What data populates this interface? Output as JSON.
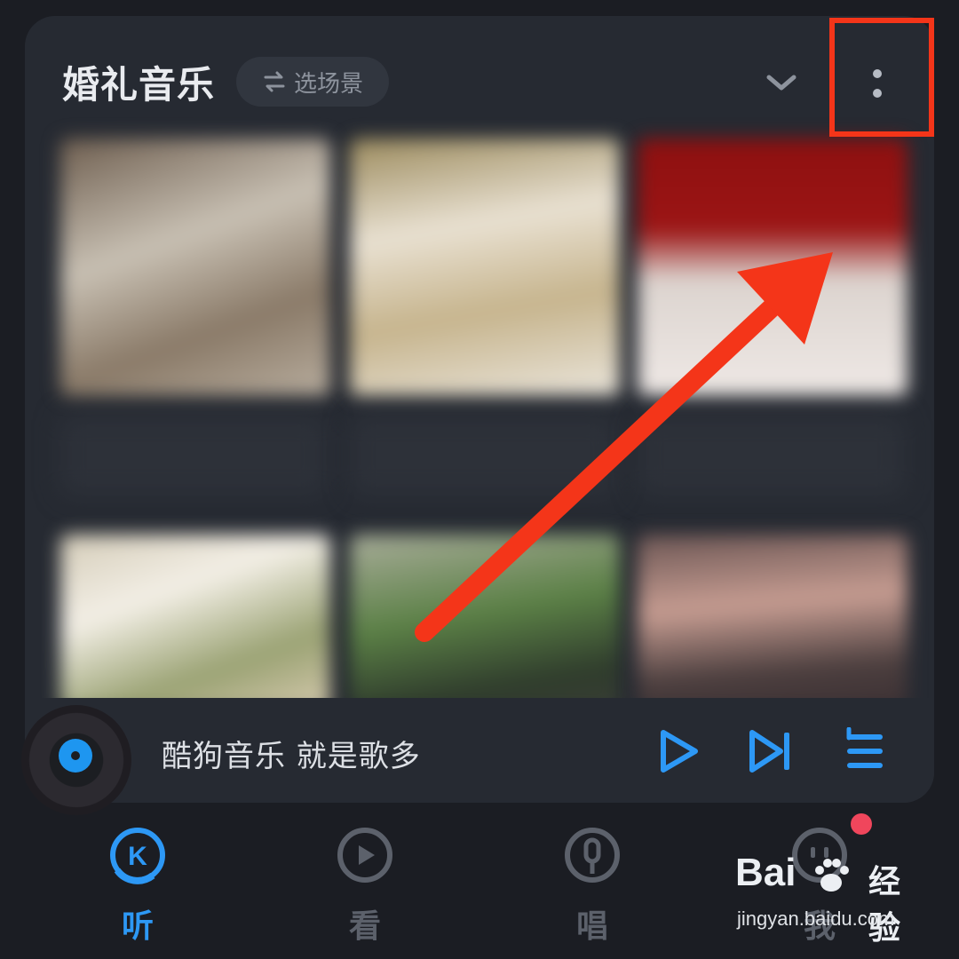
{
  "header": {
    "title": "婚礼音乐",
    "scene_button_label": "选场景"
  },
  "player": {
    "song_text": "酷狗音乐  就是歌多"
  },
  "tabs": [
    {
      "label": "听",
      "active": true
    },
    {
      "label": "看",
      "active": false
    },
    {
      "label": "唱",
      "active": false
    },
    {
      "label": "我",
      "active": false
    }
  ],
  "watermark": {
    "logo_left": "Bai",
    "logo_right": "经验",
    "url": "jingyan.baidu.com"
  },
  "colors": {
    "accent": "#2d98f5",
    "annotation": "#f43519",
    "badge": "#f0465c",
    "background": "#1b1d23",
    "card": "#262a32"
  },
  "icons": {
    "scene": "swap-arrows-icon",
    "collapse": "chevron-down-icon",
    "more": "more-vertical-icon",
    "play": "play-icon",
    "next": "skip-next-icon",
    "playlist": "playlist-icon"
  }
}
